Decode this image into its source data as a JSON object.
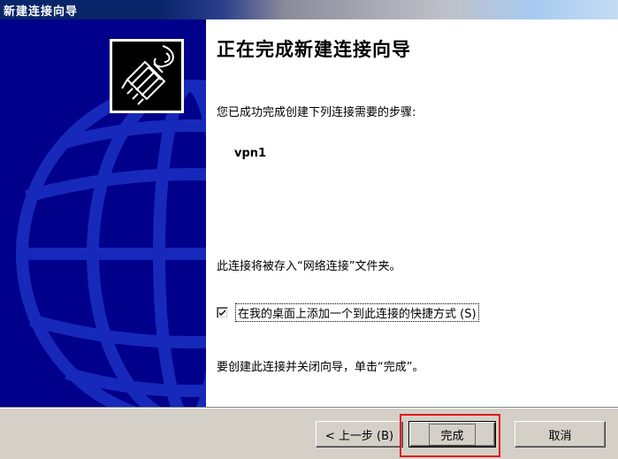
{
  "window": {
    "title": "新建连接向导"
  },
  "wizard": {
    "heading": "正在完成新建连接向导",
    "summary": "您已成功完成创建下列连接需要的步骤:",
    "connection_name": "vpn1",
    "save_note": "此连接将被存入“网络连接”文件夹。",
    "shortcut_checkbox": {
      "label": "在我的桌面上添加一个到此连接的快捷方式 (S)",
      "checked": true
    },
    "finish_note": "要创建此连接并关闭向导，单击“完成”。"
  },
  "buttons": {
    "back_label": "< 上一步 (B)",
    "finish_label": "完成",
    "cancel_label": "取消"
  },
  "icons": {
    "connection": "network-cable-icon",
    "globe": "globe-artwork"
  },
  "colors": {
    "art_background": "#00008a",
    "title_bar": "#0a246a",
    "button_face": "#d4d0c8",
    "highlight": "#e01a1a"
  }
}
